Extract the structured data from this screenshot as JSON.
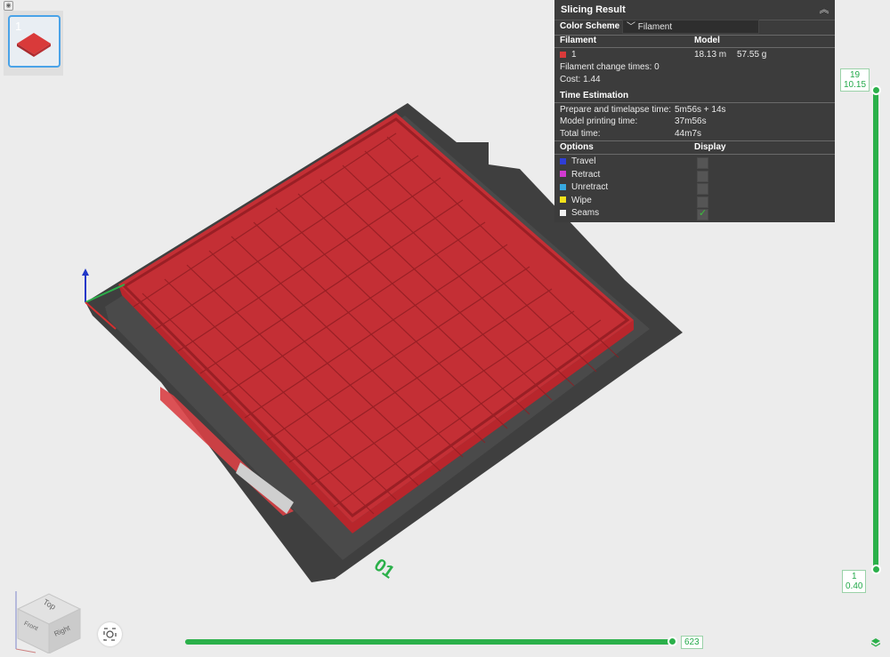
{
  "plate": {
    "number": "1"
  },
  "slicing_result": {
    "title": "Slicing Result",
    "color_scheme_label": "Color Scheme",
    "color_scheme_value": "Filament",
    "filament_header": "Filament",
    "model_header": "Model",
    "filament_id": "1",
    "filament_color": "#d93a3a",
    "model_length": "18.13 m",
    "model_weight": "57.55 g",
    "change_times_label": "Filament change times:",
    "change_times_value": "0",
    "cost_label": "Cost:",
    "cost_value": "1.44",
    "time_header": "Time Estimation",
    "prepare_label": "Prepare and timelapse time:",
    "prepare_value": "5m56s + 14s",
    "model_time_label": "Model printing time:",
    "model_time_value": "37m56s",
    "total_label": "Total time:",
    "total_value": "44m7s",
    "options_header": "Options",
    "display_header": "Display",
    "options": [
      {
        "label": "Travel",
        "color": "#2f3ed6",
        "checked": false
      },
      {
        "label": "Retract",
        "color": "#d23ad0",
        "checked": false
      },
      {
        "label": "Unretract",
        "color": "#38a9e0",
        "checked": false
      },
      {
        "label": "Wipe",
        "color": "#f2e21b",
        "checked": false
      },
      {
        "label": "Seams",
        "color": "#f2f2f2",
        "checked": true
      }
    ]
  },
  "layer_slider": {
    "top_layer": "19",
    "top_height": "10.15",
    "bottom_layer": "1",
    "bottom_height": "0.40"
  },
  "move_slider": {
    "value": "623"
  },
  "bed": {
    "label": "01"
  },
  "nav_cube": {
    "top": "Top",
    "front": "Front",
    "right": "Right"
  },
  "accent_color": "#2bb04a"
}
